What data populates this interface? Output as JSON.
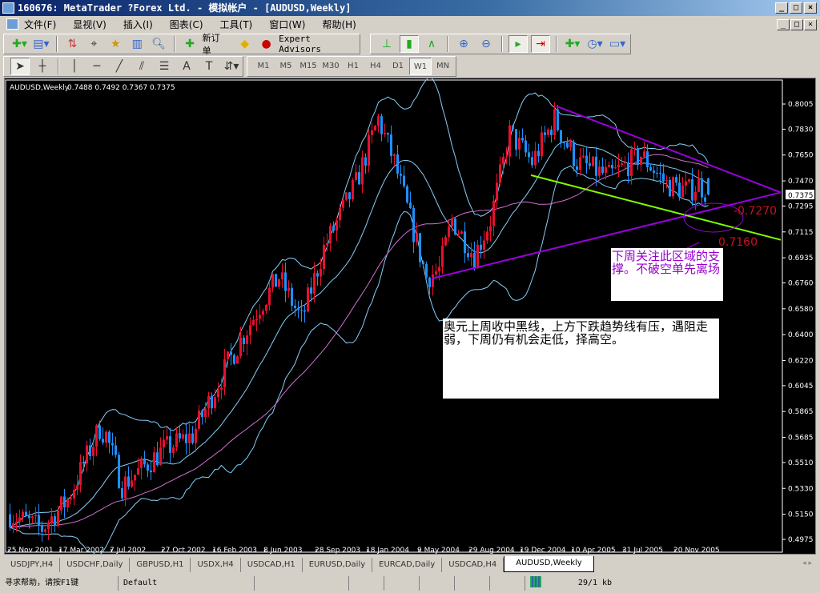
{
  "window": {
    "title": "160676: MetaTrader ?Forex Ltd. - 模拟帐户 - [AUDUSD,Weekly]",
    "btns": [
      "_",
      "□",
      "×"
    ]
  },
  "menu": [
    "文件(F)",
    "显视(V)",
    "插入(I)",
    "图表(C)",
    "工具(T)",
    "窗口(W)",
    "帮助(H)"
  ],
  "toolbar": {
    "new_order": "新订单",
    "expert_advisors": "Expert Advisors"
  },
  "timeframes": [
    "M1",
    "M5",
    "M15",
    "M30",
    "H1",
    "H4",
    "D1",
    "W1",
    "MN"
  ],
  "active_timeframe": "W1",
  "chart_header": {
    "symbol": "AUDUSD,Weekly",
    "ohlc": "0.7488 0.7492 0.7367 0.7375"
  },
  "annotations": {
    "support_note": "下周关注此区域的支撑。不破空单先离场",
    "comment": "奥元上周收中黑线，上方下跌趋势线有压，遇阻走弱，下周仍有机会走低，择高空。",
    "level_high": "-0.7270",
    "level_low": "0.7160"
  },
  "colors": {
    "up": "#e8102e",
    "down": "#1e90ff",
    "bands": "#87cefa",
    "ma": "#d070d0",
    "trend": "#9900dd",
    "support": "#80ff00",
    "label": "#cc1020"
  },
  "chart_data": {
    "type": "candlestick",
    "symbol": "AUDUSD",
    "timeframe": "Weekly",
    "current_price": "0.7375",
    "last_candle": {
      "open": 0.7488,
      "high": 0.7492,
      "low": 0.7367,
      "close": 0.7375
    },
    "ylim": [
      0.4975,
      0.8005
    ],
    "y_ticks": [
      "0.8005",
      "0.7830",
      "0.7650",
      "0.7470",
      "0.7295",
      "0.7115",
      "0.6935",
      "0.6760",
      "0.6580",
      "0.6400",
      "0.6220",
      "0.6045",
      "0.5865",
      "0.5685",
      "0.5510",
      "0.5330",
      "0.5150",
      "0.4975"
    ],
    "x_ticks": [
      "25 Nov 2001",
      "17 Mar 2002",
      "7 Jul 2002",
      "27 Oct 2002",
      "16 Feb 2003",
      "8 Jun 2003",
      "28 Sep 2003",
      "18 Jan 2004",
      "9 May 2004",
      "29 Aug 2004",
      "19 Dec 2004",
      "10 Apr 2005",
      "31 Jul 2005",
      "20 Nov 2005"
    ],
    "x_tick_week_step": 16,
    "close_path_week_price": [
      [
        0,
        0.515
      ],
      [
        10,
        0.505
      ],
      [
        18,
        0.525
      ],
      [
        28,
        0.575
      ],
      [
        30,
        0.57
      ],
      [
        35,
        0.535
      ],
      [
        48,
        0.56
      ],
      [
        57,
        0.57
      ],
      [
        68,
        0.62
      ],
      [
        78,
        0.66
      ],
      [
        84,
        0.68
      ],
      [
        91,
        0.65
      ],
      [
        98,
        0.7
      ],
      [
        108,
        0.745
      ],
      [
        115,
        0.79
      ],
      [
        120,
        0.76
      ],
      [
        125,
        0.72
      ],
      [
        130,
        0.68
      ],
      [
        134,
        0.685
      ],
      [
        138,
        0.72
      ],
      [
        145,
        0.695
      ],
      [
        150,
        0.72
      ],
      [
        156,
        0.78
      ],
      [
        163,
        0.76
      ],
      [
        170,
        0.79
      ],
      [
        172,
        0.78
      ],
      [
        177,
        0.76
      ],
      [
        187,
        0.75
      ],
      [
        197,
        0.765
      ],
      [
        205,
        0.745
      ],
      [
        212,
        0.74
      ],
      [
        215,
        0.745
      ],
      [
        218,
        0.7375
      ]
    ],
    "indicators": [
      "Bollinger Bands (20,2)",
      "Moving Average"
    ],
    "trendlines": [
      {
        "name": "resistance",
        "from": [
          171,
          0.799
        ],
        "to": [
          241,
          0.739
        ]
      },
      {
        "name": "support",
        "from": [
          132,
          0.679
        ],
        "to": [
          241,
          0.739
        ]
      },
      {
        "name": "channel",
        "from": [
          163,
          0.751
        ],
        "to": [
          241,
          0.706
        ]
      }
    ]
  },
  "tabs": [
    "USDJPY,H4",
    "USDCHF,Daily",
    "GBPUSD,H1",
    "USDX,H4",
    "USDCAD,H1",
    "EURUSD,Daily",
    "EURCAD,Daily",
    "USDCAD,H4",
    "AUDUSD,Weekly"
  ],
  "active_tab": "AUDUSD,Weekly",
  "status": {
    "help": "寻求帮助，请按F1键",
    "profile": "Default",
    "traffic": "29/1 kb"
  }
}
